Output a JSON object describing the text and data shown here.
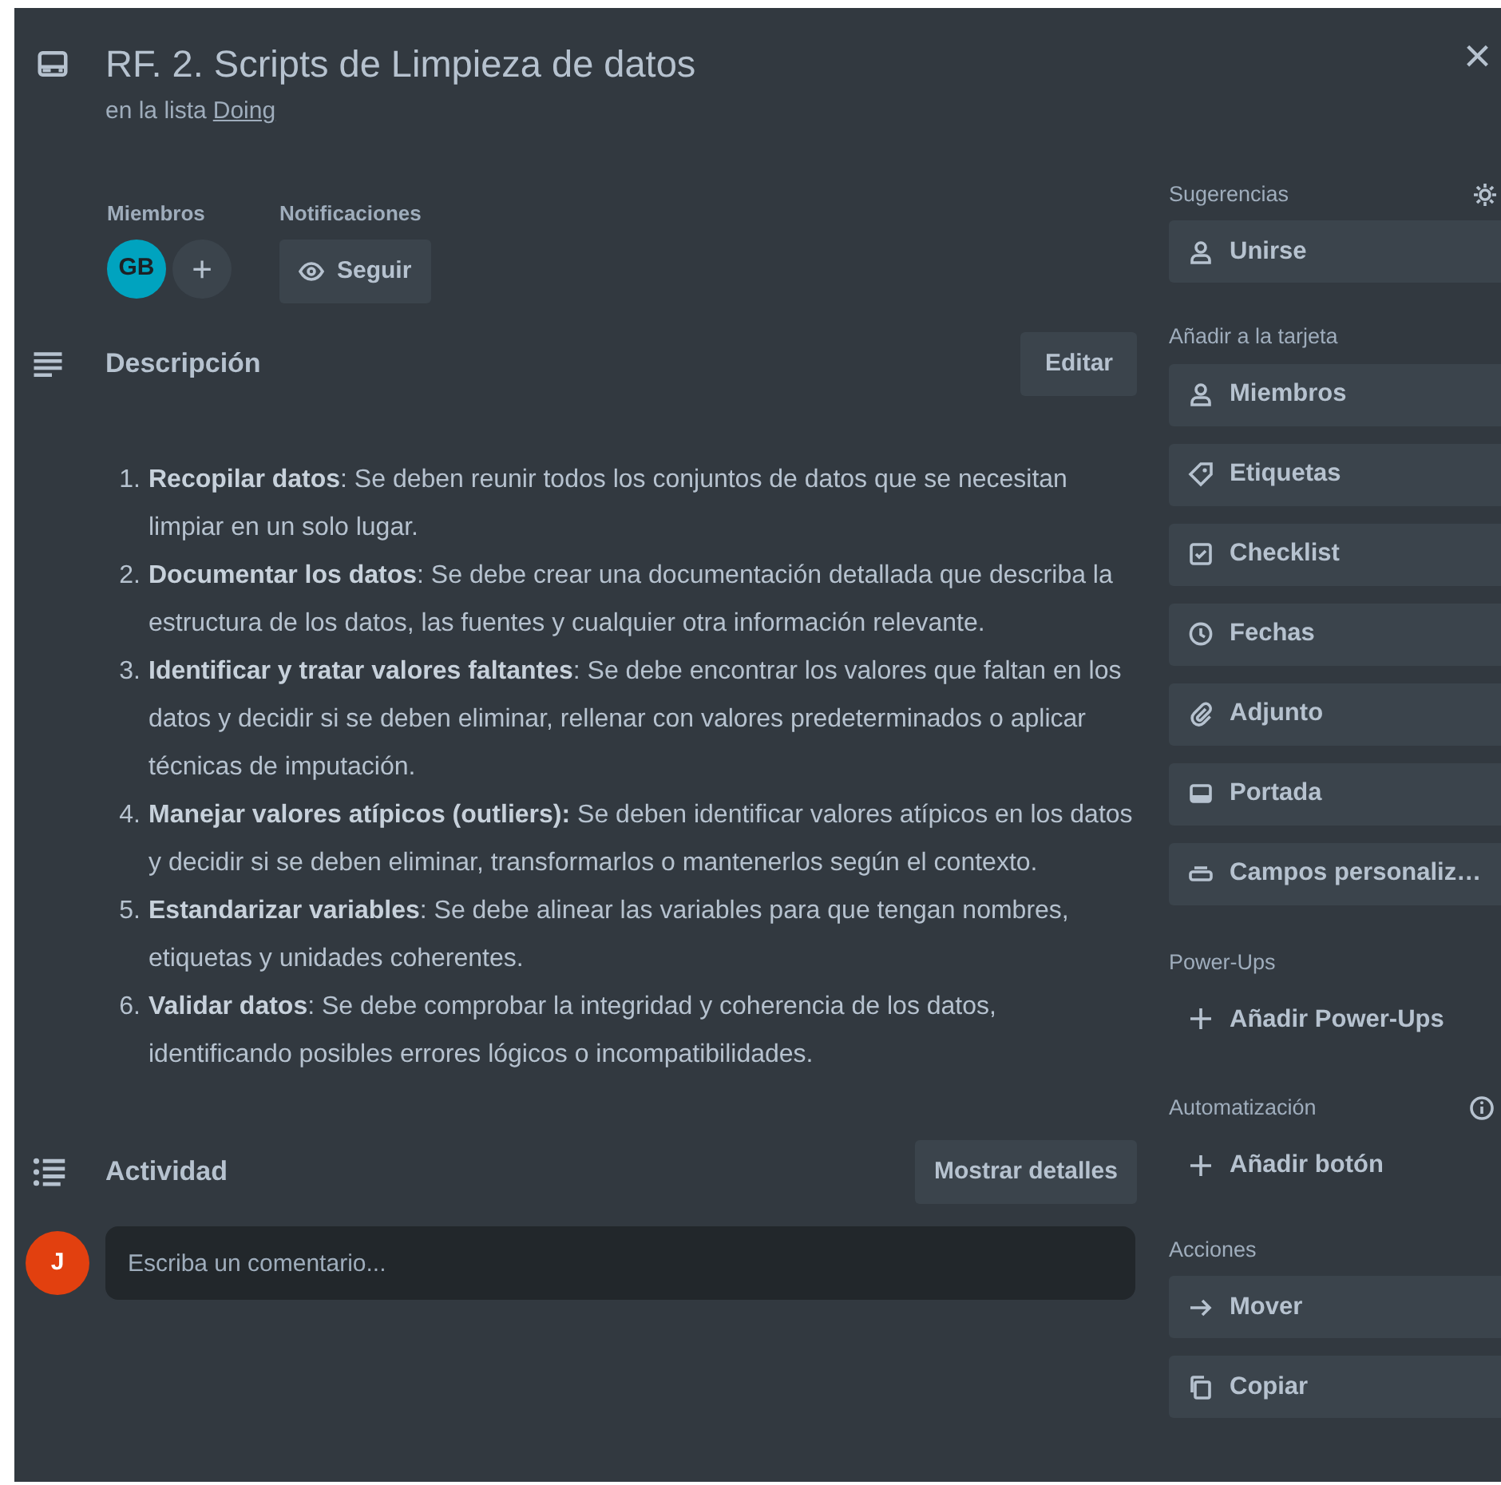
{
  "card": {
    "title": "RF. 2. Scripts de Limpieza de datos",
    "list_prefix": "en la lista",
    "list_name": "Doing"
  },
  "close": "×",
  "members": {
    "label": "Miembros",
    "avatars": [
      {
        "initials": "GB",
        "color": "#00a3bf"
      }
    ],
    "add": "+"
  },
  "notifications": {
    "label": "Notificaciones",
    "button": "Seguir"
  },
  "description": {
    "title": "Descripción",
    "edit": "Editar",
    "items": [
      {
        "number": "1.",
        "text": "**Recopilar datos**: Se deben reunir todos los conjuntos de datos que se necesitan limpiar en un solo lugar."
      },
      {
        "number": "2.",
        "text": "**Documentar los datos**: Se debe crear una documentación detallada que describa la estructura de los datos, las fuentes y cualquier otra información relevante."
      },
      {
        "number": "3.",
        "text": "**Identificar y tratar valores faltantes**: Se debe encontrar los valores que faltan en los datos y decidir si se deben eliminar, rellenar con valores predeterminados o aplicar técnicas de imputación."
      },
      {
        "number": "4.",
        "text": "**Manejar valores atípicos (outliers):** Se deben identificar valores atípicos en los datos y decidir si se deben eliminar, transformarlos o mantenerlos según el contexto."
      },
      {
        "number": "5.",
        "text": "**Estandarizar variables**: Se debe alinear las variables para que tengan nombres, etiquetas y unidades coherentes."
      },
      {
        "number": "6.",
        "text": "**Validar datos**: Se debe comprobar la integridad y coherencia de los datos, identificando posibles errores lógicos o incompatibilidades."
      }
    ]
  },
  "activity": {
    "title": "Actividad",
    "details_button": "Mostrar detalles",
    "user_initial": "J",
    "comment_placeholder": "Escriba un comentario..."
  },
  "sidebar": [
    {
      "title": "Sugerencias",
      "items": [
        {
          "label": "Unirse",
          "kind": "button"
        }
      ]
    },
    {
      "title": "Añadir a la tarjeta",
      "items": [
        {
          "label": "Miembros",
          "kind": "button"
        },
        {
          "label": "Etiquetas",
          "kind": "button"
        },
        {
          "label": "Checklist",
          "kind": "button"
        },
        {
          "label": "Fechas",
          "kind": "button"
        },
        {
          "label": "Adjunto",
          "kind": "button"
        },
        {
          "label": "Portada",
          "kind": "button"
        },
        {
          "label": "Campos personaliz…",
          "kind": "button"
        }
      ]
    },
    {
      "title": "Power-Ups",
      "items": [
        {
          "label": "Añadir Power-Ups",
          "kind": "link"
        }
      ]
    },
    {
      "title": "Automatización",
      "items": [
        {
          "label": "Añadir botón",
          "kind": "link"
        }
      ]
    },
    {
      "title": "Acciones",
      "items": [
        {
          "label": "Mover",
          "kind": "button"
        },
        {
          "label": "Copiar",
          "kind": "button"
        }
      ]
    }
  ]
}
